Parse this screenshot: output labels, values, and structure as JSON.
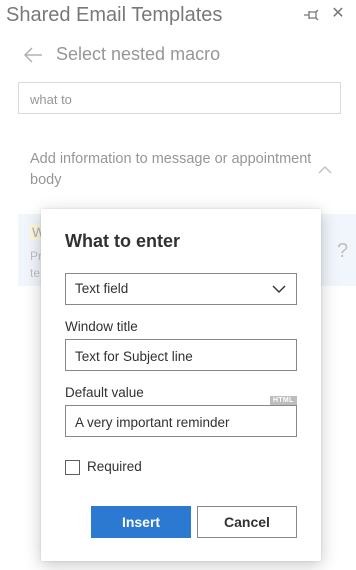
{
  "app": {
    "title": "Shared Email Templates"
  },
  "nav": {
    "title": "Select nested macro"
  },
  "search": {
    "value": "what to"
  },
  "group": {
    "title": "Add information to message or appointment body"
  },
  "background_item": {
    "title_fragment": "W",
    "desc_fragment": "Pr\nte",
    "help_glyph": "?"
  },
  "dialog": {
    "title": "What to enter",
    "type_select": {
      "value": "Text field"
    },
    "window_title_label": "Window title",
    "window_title_value": "Text for Subject line",
    "default_value_label": "Default value",
    "default_value_value": "A very important reminder",
    "html_badge": "HTML",
    "required_label": "Required",
    "required_checked": false,
    "insert_label": "Insert",
    "cancel_label": "Cancel"
  },
  "colors": {
    "accent": "#2b79d0",
    "highlight": "#eaf1fb"
  }
}
